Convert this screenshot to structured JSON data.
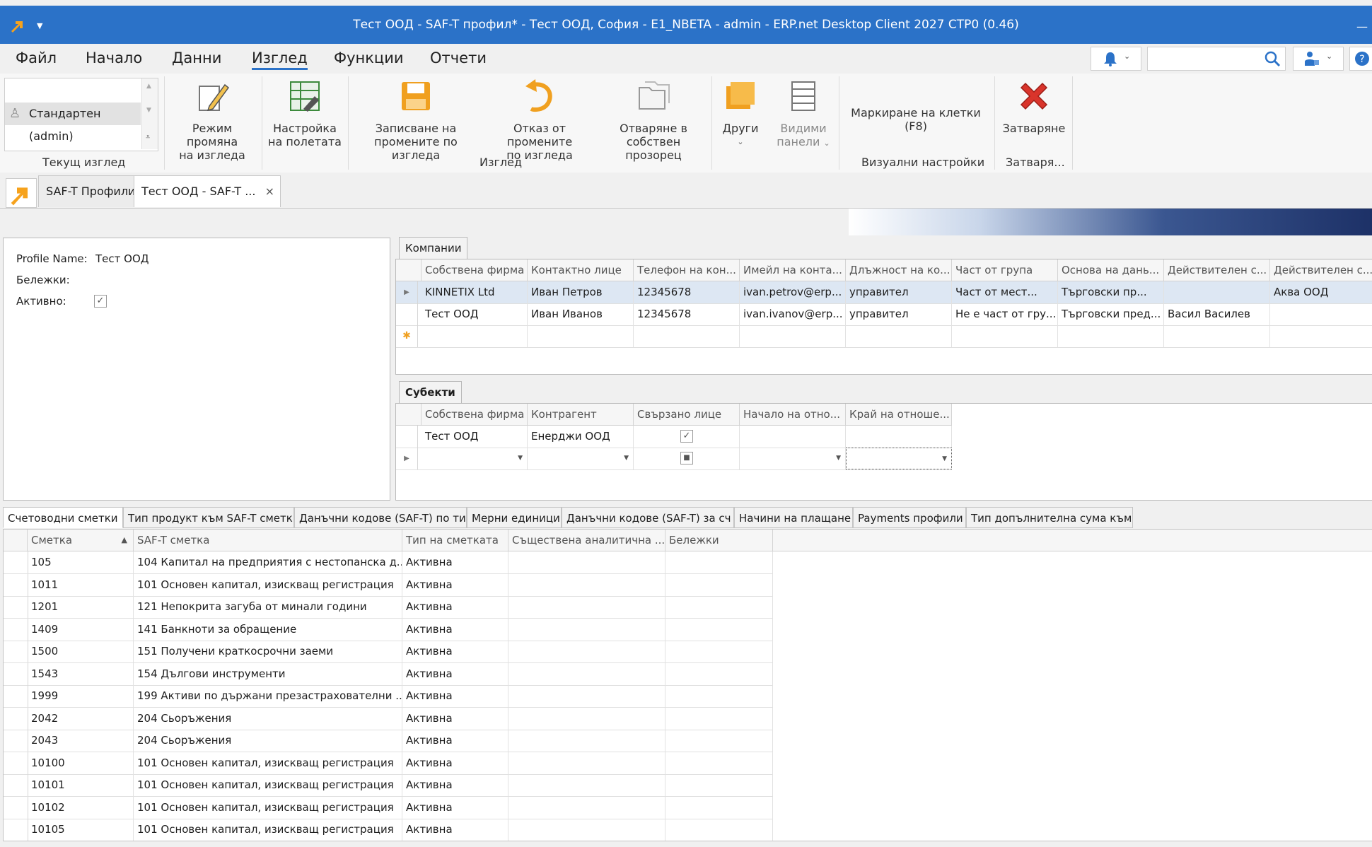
{
  "window": {
    "title": "Тест ООД - SAF-T профил* - Тест ООД, София - E1_NBETA - admin - ERP.net Desktop Client 2027 СТР0 (0.46)",
    "minimize": "—"
  },
  "menu": {
    "items": [
      "Файл",
      "Начало",
      "Данни",
      "Изглед",
      "Функции",
      "Отчети"
    ],
    "active": "Изглед"
  },
  "ribbon": {
    "current_view": {
      "selected": "Стандартен (admin)",
      "group_label": "Текущ изглед"
    },
    "buttons": {
      "edit_mode": [
        "Режим промяна",
        "на изгледа"
      ],
      "field_settings": [
        "Настройка",
        "на полетата"
      ],
      "save_changes": [
        "Записване на",
        "промените по изгледа"
      ],
      "discard_changes": [
        "Отказ от промените",
        "по изгледа"
      ],
      "open_window": [
        "Отваряне в",
        "собствен прозорец"
      ],
      "others": "Други",
      "visible_panels": [
        "Видими",
        "панели"
      ],
      "cell_marking": "Маркиране на клетки (F8)",
      "close": "Затваряне"
    },
    "group_labels": {
      "view": "Изглед",
      "visual": "Визуални настройки",
      "close": "Затваря..."
    }
  },
  "doc_tabs": [
    {
      "label": "SAF-T Профили"
    },
    {
      "label": "Тест ООД - SAF-T ..."
    }
  ],
  "form": {
    "profile_name_label": "Profile Name:",
    "profile_name": "Тест ООД",
    "notes_label": "Бележки:",
    "active_label": "Активно:",
    "active": true
  },
  "companies": {
    "caption": "Компании",
    "columns": [
      "Собствена фирма",
      "Контактно лице",
      "Телефон на кон...",
      "Имейл на конта...",
      "Длъжност на ко...",
      "Част от група",
      "Основа на дань...",
      "Действителен с...",
      "Действителен с..."
    ],
    "rows": [
      [
        "KINNETIX Ltd",
        "Иван Петров",
        "12345678",
        "ivan.petrov@erp...",
        "управител",
        "Част от мест...",
        "Търговски пр...",
        "",
        "Аква  ООД"
      ],
      [
        "Тест ООД",
        "Иван Иванов",
        "12345678",
        "ivan.ivanov@erp...",
        "управител",
        "Не е част от гру...",
        "Търговски пред...",
        "Васил Василев",
        ""
      ]
    ]
  },
  "subjects": {
    "caption": "Субекти",
    "columns": [
      "Собствена фирма",
      "Контрагент",
      "Свързано лице",
      "Начало на отно...",
      "Край на отноше..."
    ],
    "rows": [
      [
        "Тест ООД",
        "Енерджи ООД",
        "",
        "",
        ""
      ]
    ]
  },
  "bottom_tabs": [
    "Счетоводни сметки",
    "Тип продукт към SAF-T сметк",
    "Данъчни кодове (SAF-T) по ти",
    "Мерни единици",
    "Данъчни кодове (SAF-T) за сч",
    "Начини на плащане",
    "Payments профили",
    "Тип допълнителна сума към S"
  ],
  "accounts": {
    "columns": [
      "Сметка",
      "SAF-T сметка",
      "Тип на сметката",
      "Съществена аналитична ...",
      "Бележки"
    ],
    "rows": [
      [
        "105",
        "104 Капитал на предприятия с нестопанска д...",
        "Активна"
      ],
      [
        "1011",
        "101 Основен капитал, изискващ регистрация",
        "Активна"
      ],
      [
        "1201",
        "121 Непокрита загуба от минали години",
        "Активна"
      ],
      [
        "1409",
        "141 Банкноти за обращение",
        "Активна"
      ],
      [
        "1500",
        "151 Получени краткосрочни заеми",
        "Активна"
      ],
      [
        "1543",
        "154 Дългови инструменти",
        "Активна"
      ],
      [
        "1999",
        "199 Активи по държани презастрахователни ...",
        "Активна"
      ],
      [
        "2042",
        "204 Сьоръжения",
        "Активна"
      ],
      [
        "2043",
        "204 Сьоръжения",
        "Активна"
      ],
      [
        "10100",
        "101 Основен капитал, изискващ регистрация",
        "Активна"
      ],
      [
        "10101",
        "101 Основен капитал, изискващ регистрация",
        "Активна"
      ],
      [
        "10102",
        "101 Основен капитал, изискващ регистрация",
        "Активна"
      ],
      [
        "10105",
        "101 Основен капитал, изискващ регистрация",
        "Активна"
      ]
    ]
  },
  "colors": {
    "titlebar": "#2b72c8",
    "accent": "#2b72c8",
    "close_red": "#d9342b",
    "folder_orange": "#f0a020"
  },
  "icons": [
    "app-logo-icon",
    "bell-icon",
    "search-icon",
    "user-settings-icon",
    "help-icon",
    "pencil-icon",
    "field-settings-icon",
    "save-icon",
    "undo-icon",
    "open-window-icon",
    "folders-icon",
    "panels-icon",
    "close-x-icon"
  ]
}
